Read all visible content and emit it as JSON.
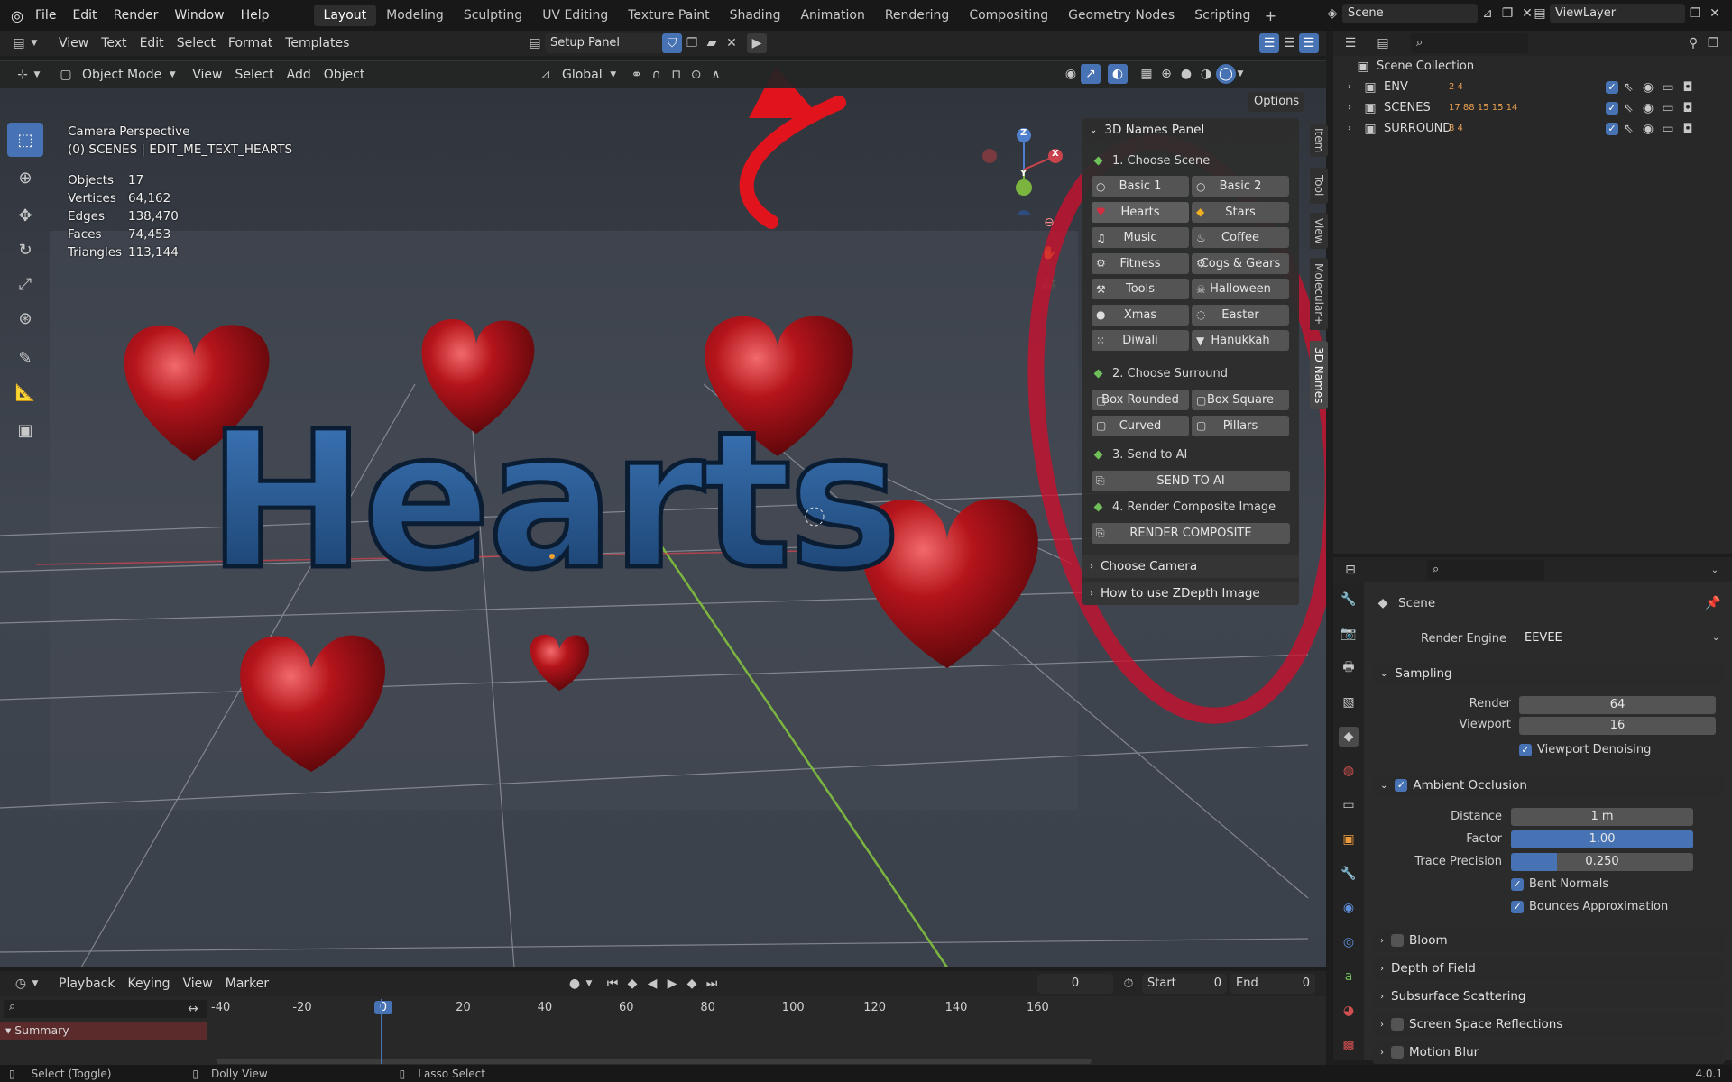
{
  "menu": {
    "items": [
      "File",
      "Edit",
      "Render",
      "Window",
      "Help"
    ]
  },
  "workspaces": [
    "Layout",
    "Modeling",
    "Sculpting",
    "UV Editing",
    "Texture Paint",
    "Shading",
    "Animation",
    "Rendering",
    "Compositing",
    "Geometry Nodes",
    "Scripting"
  ],
  "scene_field": "Scene",
  "viewlayer_field": "ViewLayer",
  "text_editor": {
    "menus": [
      "View",
      "Text",
      "Edit",
      "Select",
      "Format",
      "Templates"
    ],
    "file_name": "Setup Panel"
  },
  "viewport_header": {
    "mode": "Object Mode",
    "menus": [
      "View",
      "Select",
      "Add",
      "Object"
    ],
    "orientation": "Global",
    "options": "Options"
  },
  "overlay_info": {
    "line1": "Camera Perspective",
    "line2": "(0) SCENES | EDIT_ME_TEXT_HEARTS",
    "stats": [
      {
        "k": "Objects",
        "v": "17"
      },
      {
        "k": "Vertices",
        "v": "64,162"
      },
      {
        "k": "Edges",
        "v": "138,470"
      },
      {
        "k": "Faces",
        "v": "74,453"
      },
      {
        "k": "Triangles",
        "v": "113,144"
      }
    ]
  },
  "scene_text": "Hearts",
  "gizmo": {
    "x": "X",
    "y": "Y",
    "z": "Z"
  },
  "npanel": {
    "title": "3D Names Panel",
    "step1": "1. Choose Scene",
    "scene_buttons": [
      "Basic 1",
      "Basic 2",
      "Hearts",
      "Stars",
      "Music",
      "Coffee",
      "Fitness",
      "Cogs & Gears",
      "Tools",
      "Halloween",
      "Xmas",
      "Easter",
      "Diwali",
      "Hanukkah"
    ],
    "step2": "2. Choose Surround",
    "surround_buttons": [
      "Box Rounded",
      "Box Square",
      "Curved",
      "Pillars"
    ],
    "step3": "3. Send to AI",
    "send_ai": "SEND TO AI",
    "step4": "4. Render Composite Image",
    "render_comp": "RENDER COMPOSITE",
    "choose_camera": "Choose Camera",
    "zdepth": "How to use ZDepth Image",
    "tabs": [
      "Item",
      "Tool",
      "View",
      "Molecular+",
      "3D Names"
    ]
  },
  "outliner": {
    "root": "Scene Collection",
    "items": [
      {
        "name": "ENV",
        "counts": "2 4"
      },
      {
        "name": "SCENES",
        "counts": "17 88 15 15 14"
      },
      {
        "name": "SURROUND",
        "counts": "8 4"
      }
    ]
  },
  "properties": {
    "context": "Scene",
    "render_engine_label": "Render Engine",
    "render_engine": "EEVEE",
    "sampling": "Sampling",
    "render_label": "Render",
    "render_val": "64",
    "viewport_label": "Viewport",
    "viewport_val": "16",
    "denoise": "Viewport Denoising",
    "ao": "Ambient Occlusion",
    "distance_label": "Distance",
    "distance": "1 m",
    "factor_label": "Factor",
    "factor": "1.00",
    "factor_fill": 1.0,
    "trace_label": "Trace Precision",
    "trace": "0.250",
    "trace_fill": 0.25,
    "bent": "Bent Normals",
    "bounces": "Bounces Approximation",
    "sections": [
      "Bloom",
      "Depth of Field",
      "Subsurface Scattering",
      "Screen Space Reflections",
      "Motion Blur"
    ]
  },
  "timeline": {
    "menus": [
      "Playback",
      "Keying",
      "View",
      "Marker"
    ],
    "frame": "0",
    "start_label": "Start",
    "start": "0",
    "end_label": "End",
    "end": "0",
    "ticks": [
      "-40",
      "-20",
      "0",
      "20",
      "40",
      "60",
      "80",
      "100",
      "120",
      "140",
      "160"
    ],
    "summary": "Summary"
  },
  "statusbar": {
    "a": "Select (Toggle)",
    "b": "Dolly View",
    "c": "Lasso Select",
    "version": "4.0.1"
  },
  "colors": {
    "accent": "#4772b3",
    "annotation": "#c8102e",
    "x_axis": "#c8434c",
    "y_axis": "#7bb540",
    "z_axis": "#4f7fcc"
  }
}
